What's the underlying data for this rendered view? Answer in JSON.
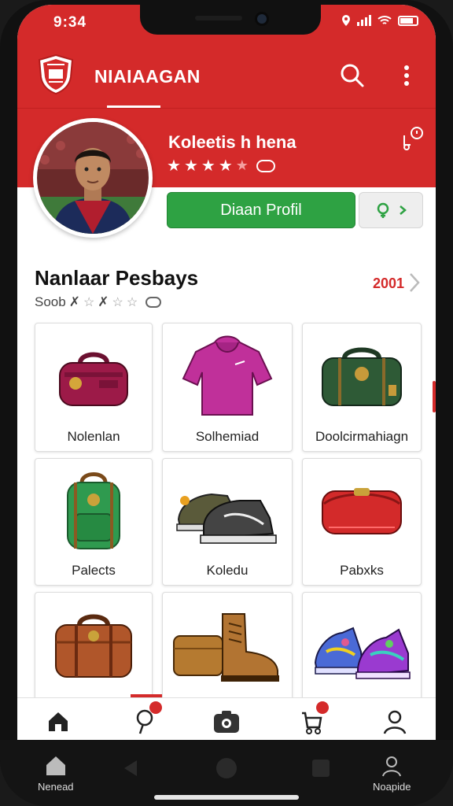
{
  "status_bar": {
    "time": "9:34"
  },
  "app_bar": {
    "title": "NIAIAAGAN",
    "logo_icon": "club-crest-icon",
    "search_icon": "search-icon",
    "more_icon": "more-vertical-icon"
  },
  "profile": {
    "name": "Koleetis h hena",
    "rating": {
      "filled": 4,
      "outline": 1
    },
    "primary_button": "Diaan Profil"
  },
  "section": {
    "title": "Nanlaar Pesbays",
    "subtitle": "Soob",
    "count": "2001"
  },
  "products": [
    {
      "label": "Nolenlan",
      "icon": "duffel-bag-icon"
    },
    {
      "label": "Solhemiad",
      "icon": "hoodie-icon"
    },
    {
      "label": "Doolcirmahiagn",
      "icon": "travel-bag-icon"
    },
    {
      "label": "Palects",
      "icon": "backpack-icon"
    },
    {
      "label": "Koledu",
      "icon": "sneakers-icon"
    },
    {
      "label": "Pabxks",
      "icon": "pouch-bag-icon"
    },
    {
      "label": "",
      "icon": "satchel-icon"
    },
    {
      "label": "",
      "icon": "boots-icon"
    },
    {
      "label": "",
      "icon": "colorful-sneakers-icon"
    }
  ],
  "bottom_nav": [
    {
      "name": "home",
      "icon": "home-icon"
    },
    {
      "name": "notifications",
      "icon": "pin-icon"
    },
    {
      "name": "camera",
      "icon": "camera-icon"
    },
    {
      "name": "cart",
      "icon": "cart-icon"
    },
    {
      "name": "profile",
      "icon": "person-icon"
    }
  ],
  "system_bar": {
    "left_label": "Nenead",
    "right_label": "Noapide"
  },
  "colors": {
    "brand_red": "#d42a2a",
    "action_green": "#2ea243"
  }
}
